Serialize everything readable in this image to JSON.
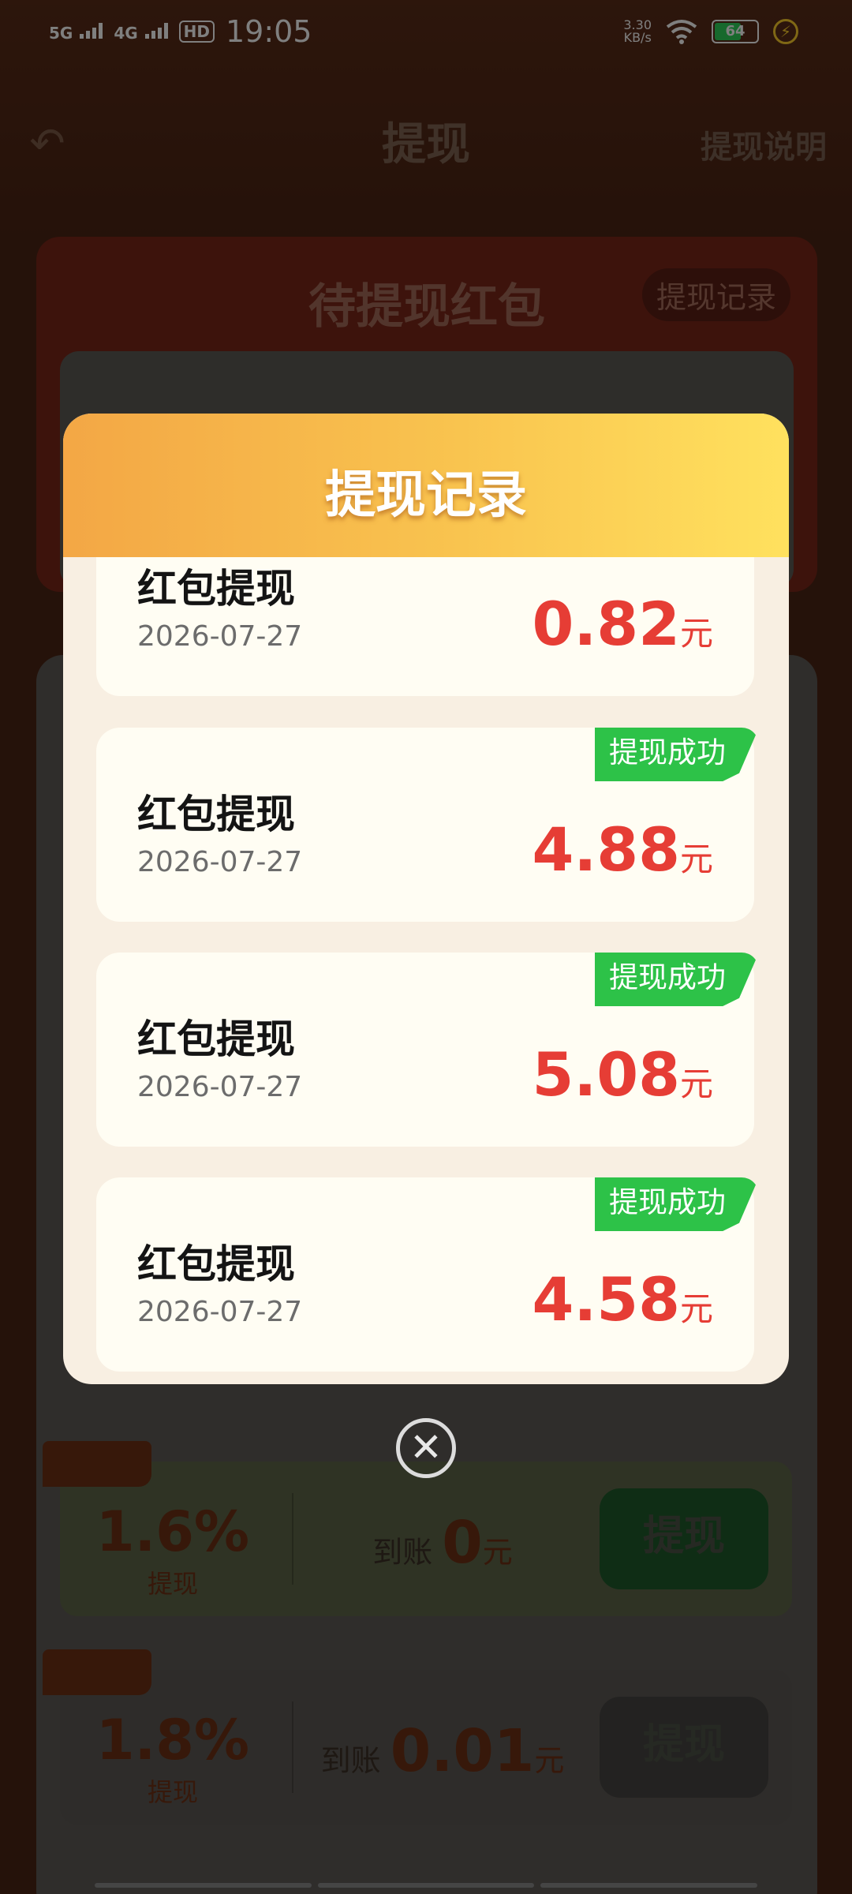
{
  "status_bar": {
    "network1": "5G",
    "network2": "4G",
    "hd": "HD",
    "time": "19:05",
    "speed_value": "3.30",
    "speed_unit": "KB/s",
    "battery": "64"
  },
  "header": {
    "back_icon": "back-arrow-icon",
    "title": "提现",
    "explain": "提现说明"
  },
  "pending": {
    "title": "待提现红包",
    "record_button": "提现记录"
  },
  "options": [
    {
      "percent": "1.6%",
      "label": "提现",
      "arrive_prefix": "到账",
      "amount": "0",
      "unit": "元",
      "button": "提现",
      "color": "#5e6648",
      "button_color": "#1f5a2b"
    },
    {
      "percent": "1.8%",
      "label": "提现",
      "arrive_prefix": "到账",
      "amount": "0.01",
      "unit": "元",
      "button": "提现",
      "color": "#5d5954",
      "button_color": "#474542"
    }
  ],
  "modal": {
    "title": "提现记录",
    "records": [
      {
        "title": "红包提现",
        "date": "2026-07-27",
        "amount": "0.82",
        "unit": "元",
        "badge": ""
      },
      {
        "title": "红包提现",
        "date": "2026-07-27",
        "amount": "4.88",
        "unit": "元",
        "badge": "提现成功"
      },
      {
        "title": "红包提现",
        "date": "2026-07-27",
        "amount": "5.08",
        "unit": "元",
        "badge": "提现成功"
      },
      {
        "title": "红包提现",
        "date": "2026-07-27",
        "amount": "4.58",
        "unit": "元",
        "badge": "提现成功"
      }
    ],
    "close_icon": "close-circle-icon",
    "close_glyph": "✕"
  },
  "colors": {
    "accent_red": "#e63d35",
    "success_green": "#2dc248",
    "header_orange": "#f3a745",
    "header_yellow": "#ffe15e"
  }
}
